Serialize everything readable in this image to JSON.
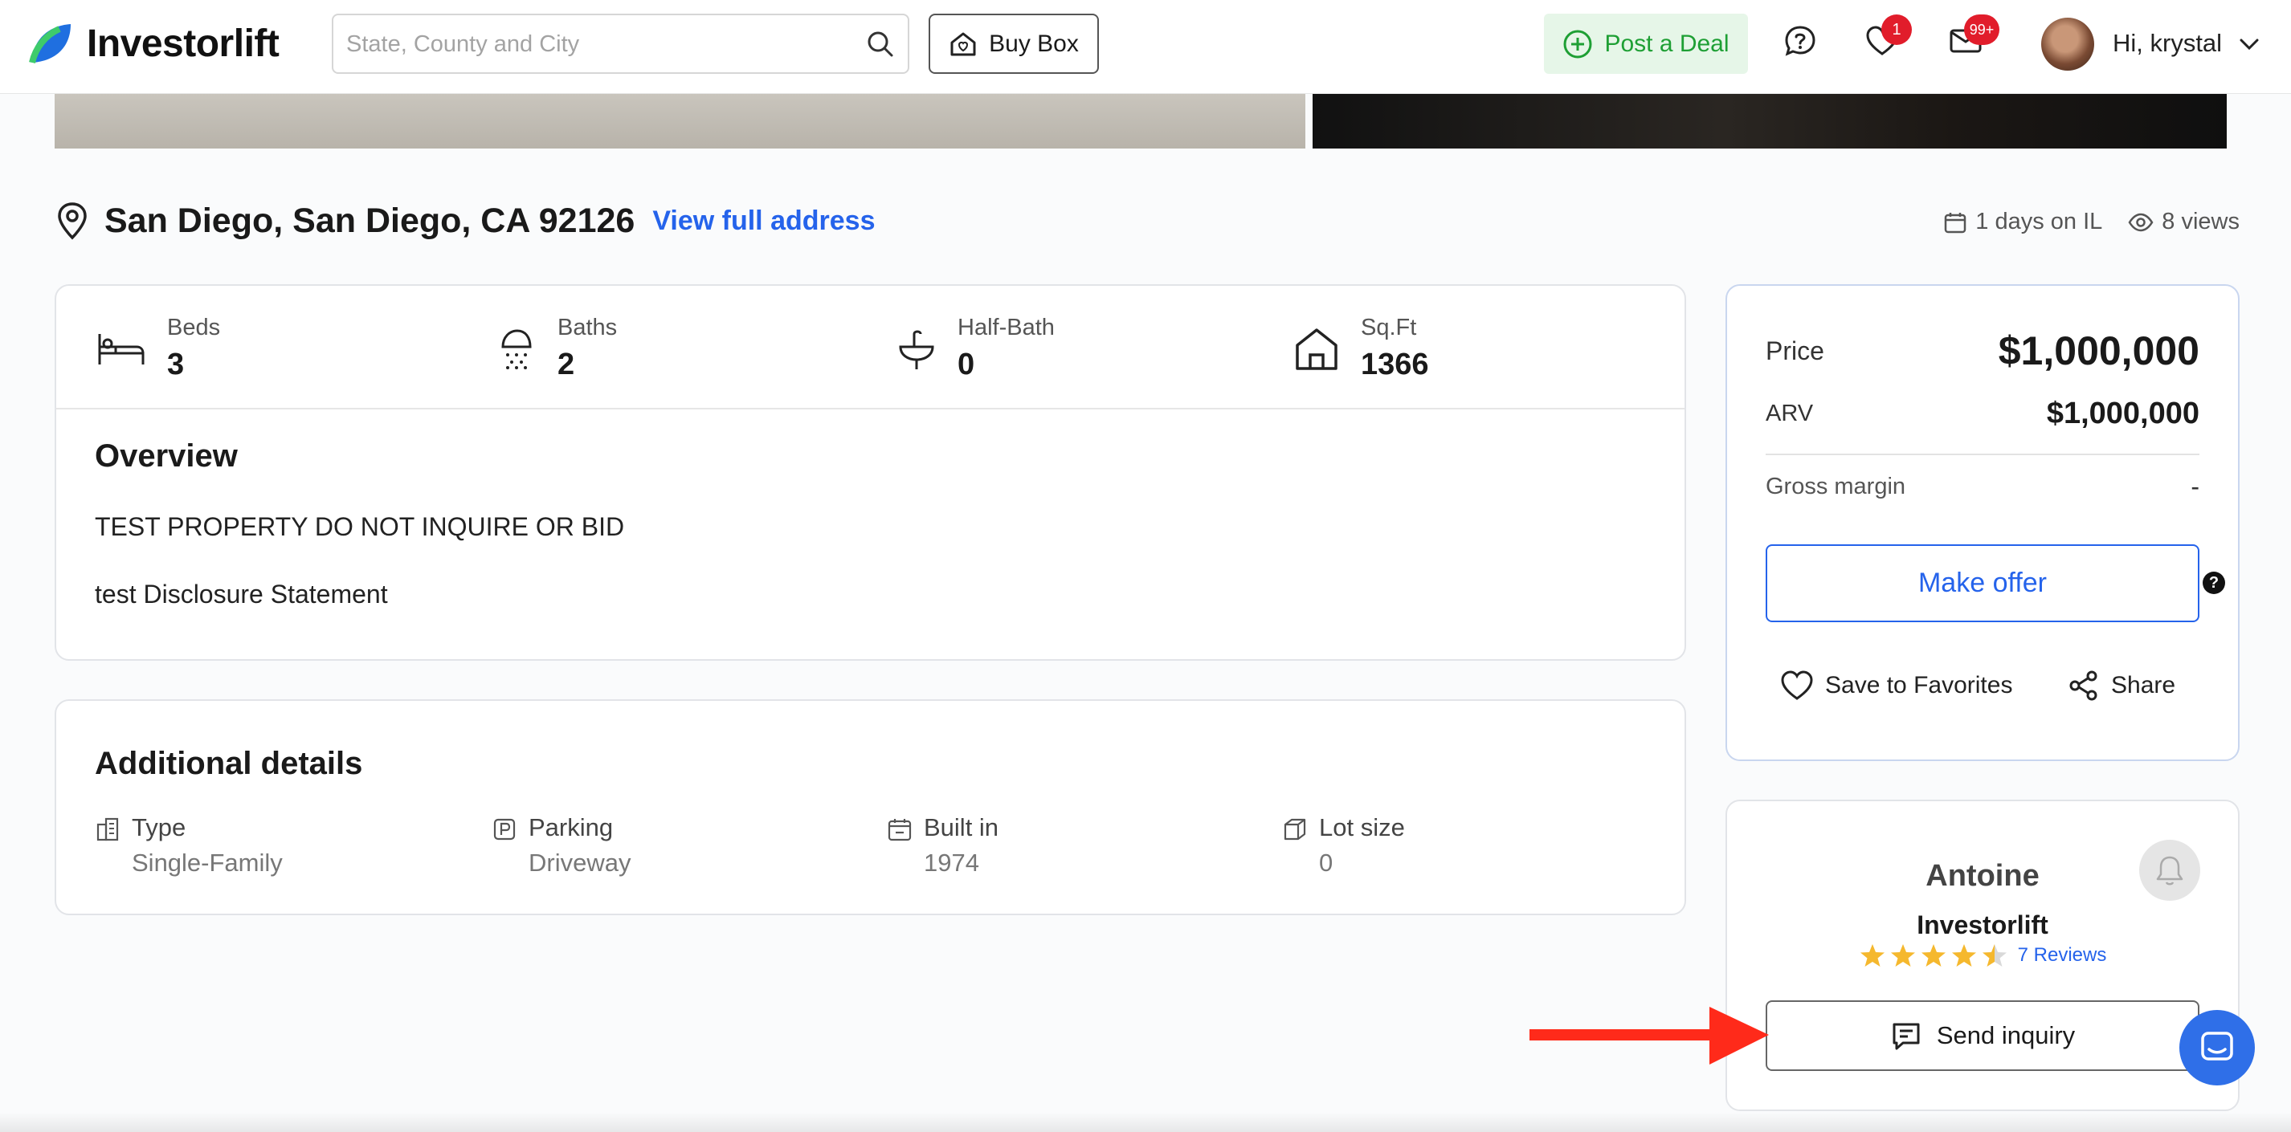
{
  "header": {
    "logo_text": "Investorlift",
    "search_placeholder": "State, County and City",
    "buy_box_label": "Buy Box",
    "post_deal_label": "Post a Deal",
    "favorites_badge": "1",
    "messages_badge": "99+",
    "greeting": "Hi, krystal"
  },
  "property": {
    "address": "San Diego, San Diego, CA 92126",
    "view_full_address": "View full address",
    "days_on": "1 days on IL",
    "views": "8 views",
    "stats": [
      {
        "label": "Beds",
        "value": "3",
        "icon": "bed-icon"
      },
      {
        "label": "Baths",
        "value": "2",
        "icon": "shower-icon"
      },
      {
        "label": "Half-Bath",
        "value": "0",
        "icon": "sink-icon"
      },
      {
        "label": "Sq.Ft",
        "value": "1366",
        "icon": "house-icon"
      }
    ],
    "overview": {
      "title": "Overview",
      "line1": "TEST PROPERTY DO NOT INQUIRE OR BID",
      "line2": "test Disclosure Statement"
    },
    "additional": {
      "title": "Additional details",
      "items": [
        {
          "label": "Type",
          "value": "Single-Family",
          "icon": "building-icon"
        },
        {
          "label": "Parking",
          "value": "Driveway",
          "icon": "parking-icon"
        },
        {
          "label": "Built in",
          "value": "1974",
          "icon": "calendar-icon"
        },
        {
          "label": "Lot size",
          "value": "0",
          "icon": "cube-icon"
        }
      ]
    }
  },
  "pricing": {
    "price_label": "Price",
    "price_value": "$1,000,000",
    "arv_label": "ARV",
    "arv_value": "$1,000,000",
    "margin_label": "Gross margin",
    "margin_value": "-",
    "make_offer": "Make offer",
    "help": "?",
    "save_favorites": "Save to Favorites",
    "share": "Share"
  },
  "seller": {
    "name": "Antoine",
    "company": "Investorlift",
    "rating": 4.5,
    "reviews": "7 Reviews",
    "send_inquiry": "Send inquiry"
  },
  "colors": {
    "accent_blue": "#2563eb",
    "post_deal_green": "#1e9f34",
    "badge_red": "#e11d2b",
    "star_gold": "#f5b82e",
    "annotation_arrow": "#ff2a1a"
  }
}
